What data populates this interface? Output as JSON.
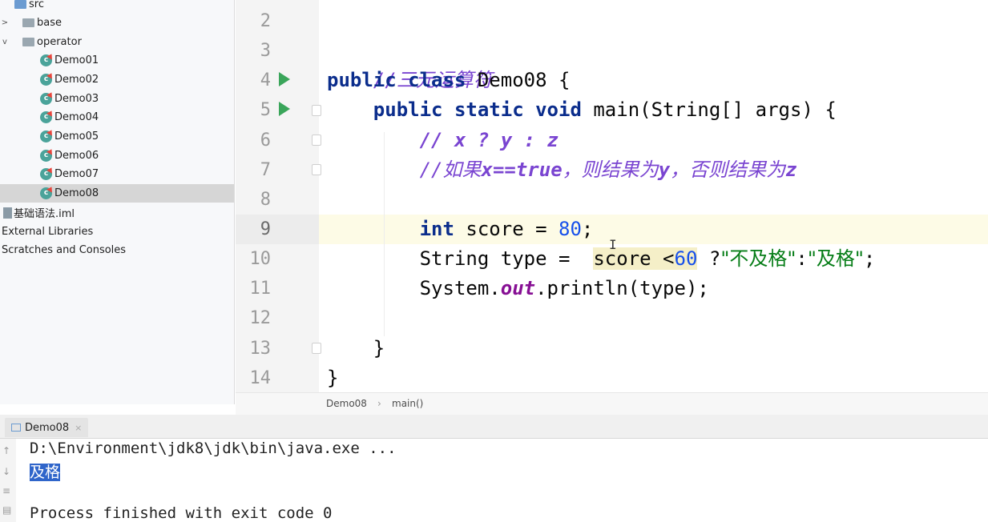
{
  "project_tree": {
    "items": [
      {
        "label": "src",
        "icon": "folder-icon",
        "chevron": ""
      },
      {
        "label": "base",
        "icon": "folder-icon",
        "chevron": ">"
      },
      {
        "label": "operator",
        "icon": "folder-icon",
        "chevron": "v"
      },
      {
        "label": "Demo01",
        "icon": "java-class-icon"
      },
      {
        "label": "Demo02",
        "icon": "java-class-icon"
      },
      {
        "label": "Demo03",
        "icon": "java-class-icon"
      },
      {
        "label": "Demo04",
        "icon": "java-class-icon"
      },
      {
        "label": "Demo05",
        "icon": "java-class-icon"
      },
      {
        "label": "Demo06",
        "icon": "java-class-icon"
      },
      {
        "label": "Demo07",
        "icon": "java-class-icon"
      },
      {
        "label": "Demo08",
        "icon": "java-class-icon",
        "selected": true
      },
      {
        "label": "基础语法.iml",
        "icon": "iml-file-icon"
      },
      {
        "label": "External Libraries",
        "icon": ""
      },
      {
        "label": "Scratches and Consoles",
        "icon": ""
      }
    ]
  },
  "editor": {
    "line_numbers": [
      "2",
      "3",
      "4",
      "5",
      "6",
      "7",
      "8",
      "9",
      "10",
      "11",
      "12",
      "13",
      "14"
    ],
    "current_line": "9",
    "code": {
      "l3_comment": "//三元运算符",
      "l4_kw1": "public",
      "l4_kw2": "class",
      "l4_rest": "Demo08 {",
      "l5_kw1": "public",
      "l5_kw2": "static",
      "l5_kw3": "void",
      "l5_rest": "main(String[] args) {",
      "l6_comment": "// x ? y : z",
      "l7_c1": "//如果",
      "l7_c2": "x==true",
      "l7_c3": "，则结果为",
      "l7_c4": "y",
      "l7_c5": "，否则结果为",
      "l7_c6": "z",
      "l9_kw": "int",
      "l9_rest": "score = ",
      "l9_num": "80",
      "l9_end": ";",
      "l10_a": "String type = ",
      "l10_b": "score <",
      "l10_num": "60",
      "l10_c": " ?",
      "l10_s1": "\"不及格\"",
      "l10_d": ":",
      "l10_s2": "\"及格\"",
      "l10_e": ";",
      "l11_a": "System.",
      "l11_field": "out",
      "l11_b": ".println(type);",
      "l13": "}",
      "l14": "}"
    }
  },
  "breadcrumb": {
    "items": [
      "Demo08",
      "main()"
    ],
    "separator": "›"
  },
  "run_panel": {
    "tab_label": "Demo08",
    "tab_close": "×",
    "console_lines": {
      "command": "D:\\Environment\\jdk8\\jdk\\bin\\java.exe ...",
      "output": "及格",
      "exit": "Process finished with exit code 0"
    }
  },
  "colors": {
    "keyword": "#0b2d8c",
    "comment": "#7a45d1",
    "string": "#067d17",
    "number": "#1750eb",
    "run_icon": "#3aa55a",
    "selection": "#2f65ca"
  }
}
